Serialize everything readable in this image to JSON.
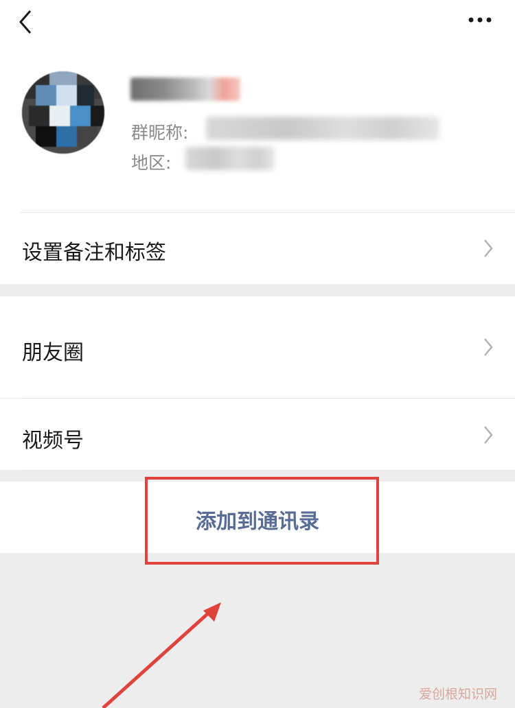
{
  "profile": {
    "nickname_label": "群昵称:",
    "region_label": "地区:"
  },
  "menu": {
    "remark_tags": "设置备注和标签",
    "moments": "朋友圈",
    "channels": "视频号"
  },
  "action": {
    "add_contact": "添加到通讯录"
  },
  "watermark": "爱创根知识网",
  "colors": {
    "highlight": "#e0433b",
    "link": "#576b95"
  }
}
